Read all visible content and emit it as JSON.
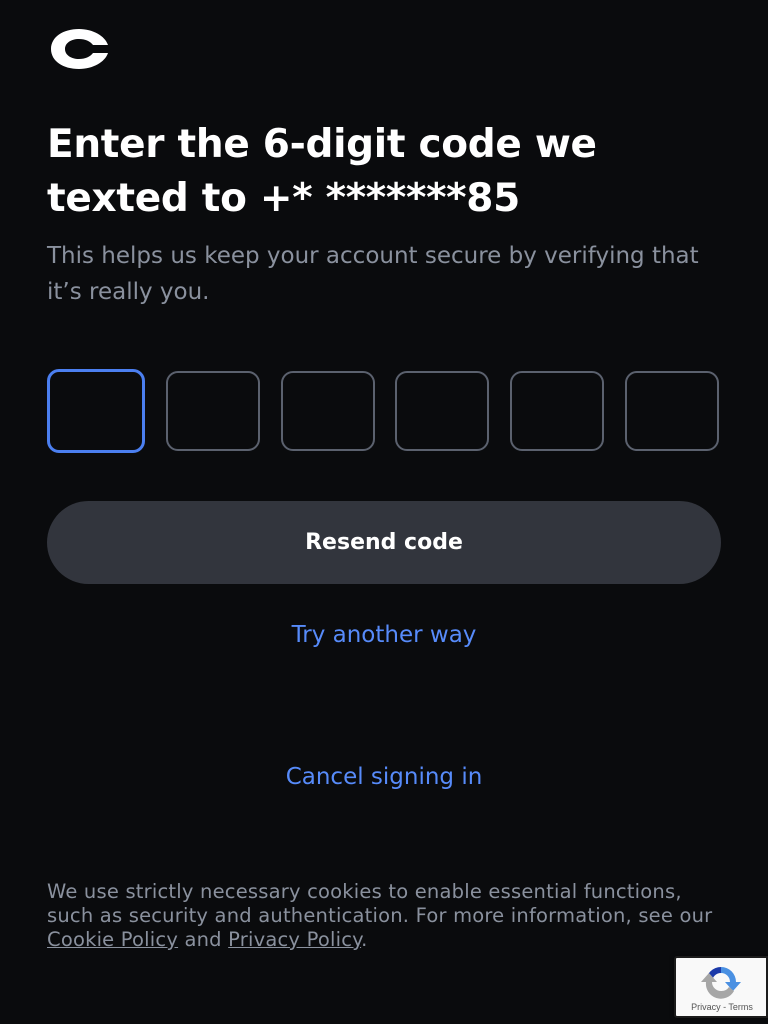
{
  "brand": {
    "logo_icon": "coinbase-c-icon",
    "accent_color": "#578bfa"
  },
  "title": "Enter the 6-digit code we texted to +* *******85",
  "subtitle": "This helps us keep your account secure by verifying that it’s really you.",
  "code_inputs": [
    "",
    "",
    "",
    "",
    "",
    ""
  ],
  "resend_label": "Resend code",
  "try_another_label": "Try another way",
  "cancel_label": "Cancel signing in",
  "cookie_notice": {
    "text_before": "We use strictly necessary cookies to enable essential functions, such as security and authentication. For more information, see our ",
    "cookie_policy_link": "Cookie Policy",
    "and_text": " and ",
    "privacy_policy_link": "Privacy Policy",
    "period": "."
  },
  "recaptcha": {
    "icon": "recaptcha-icon",
    "footer": "Privacy - Terms"
  }
}
